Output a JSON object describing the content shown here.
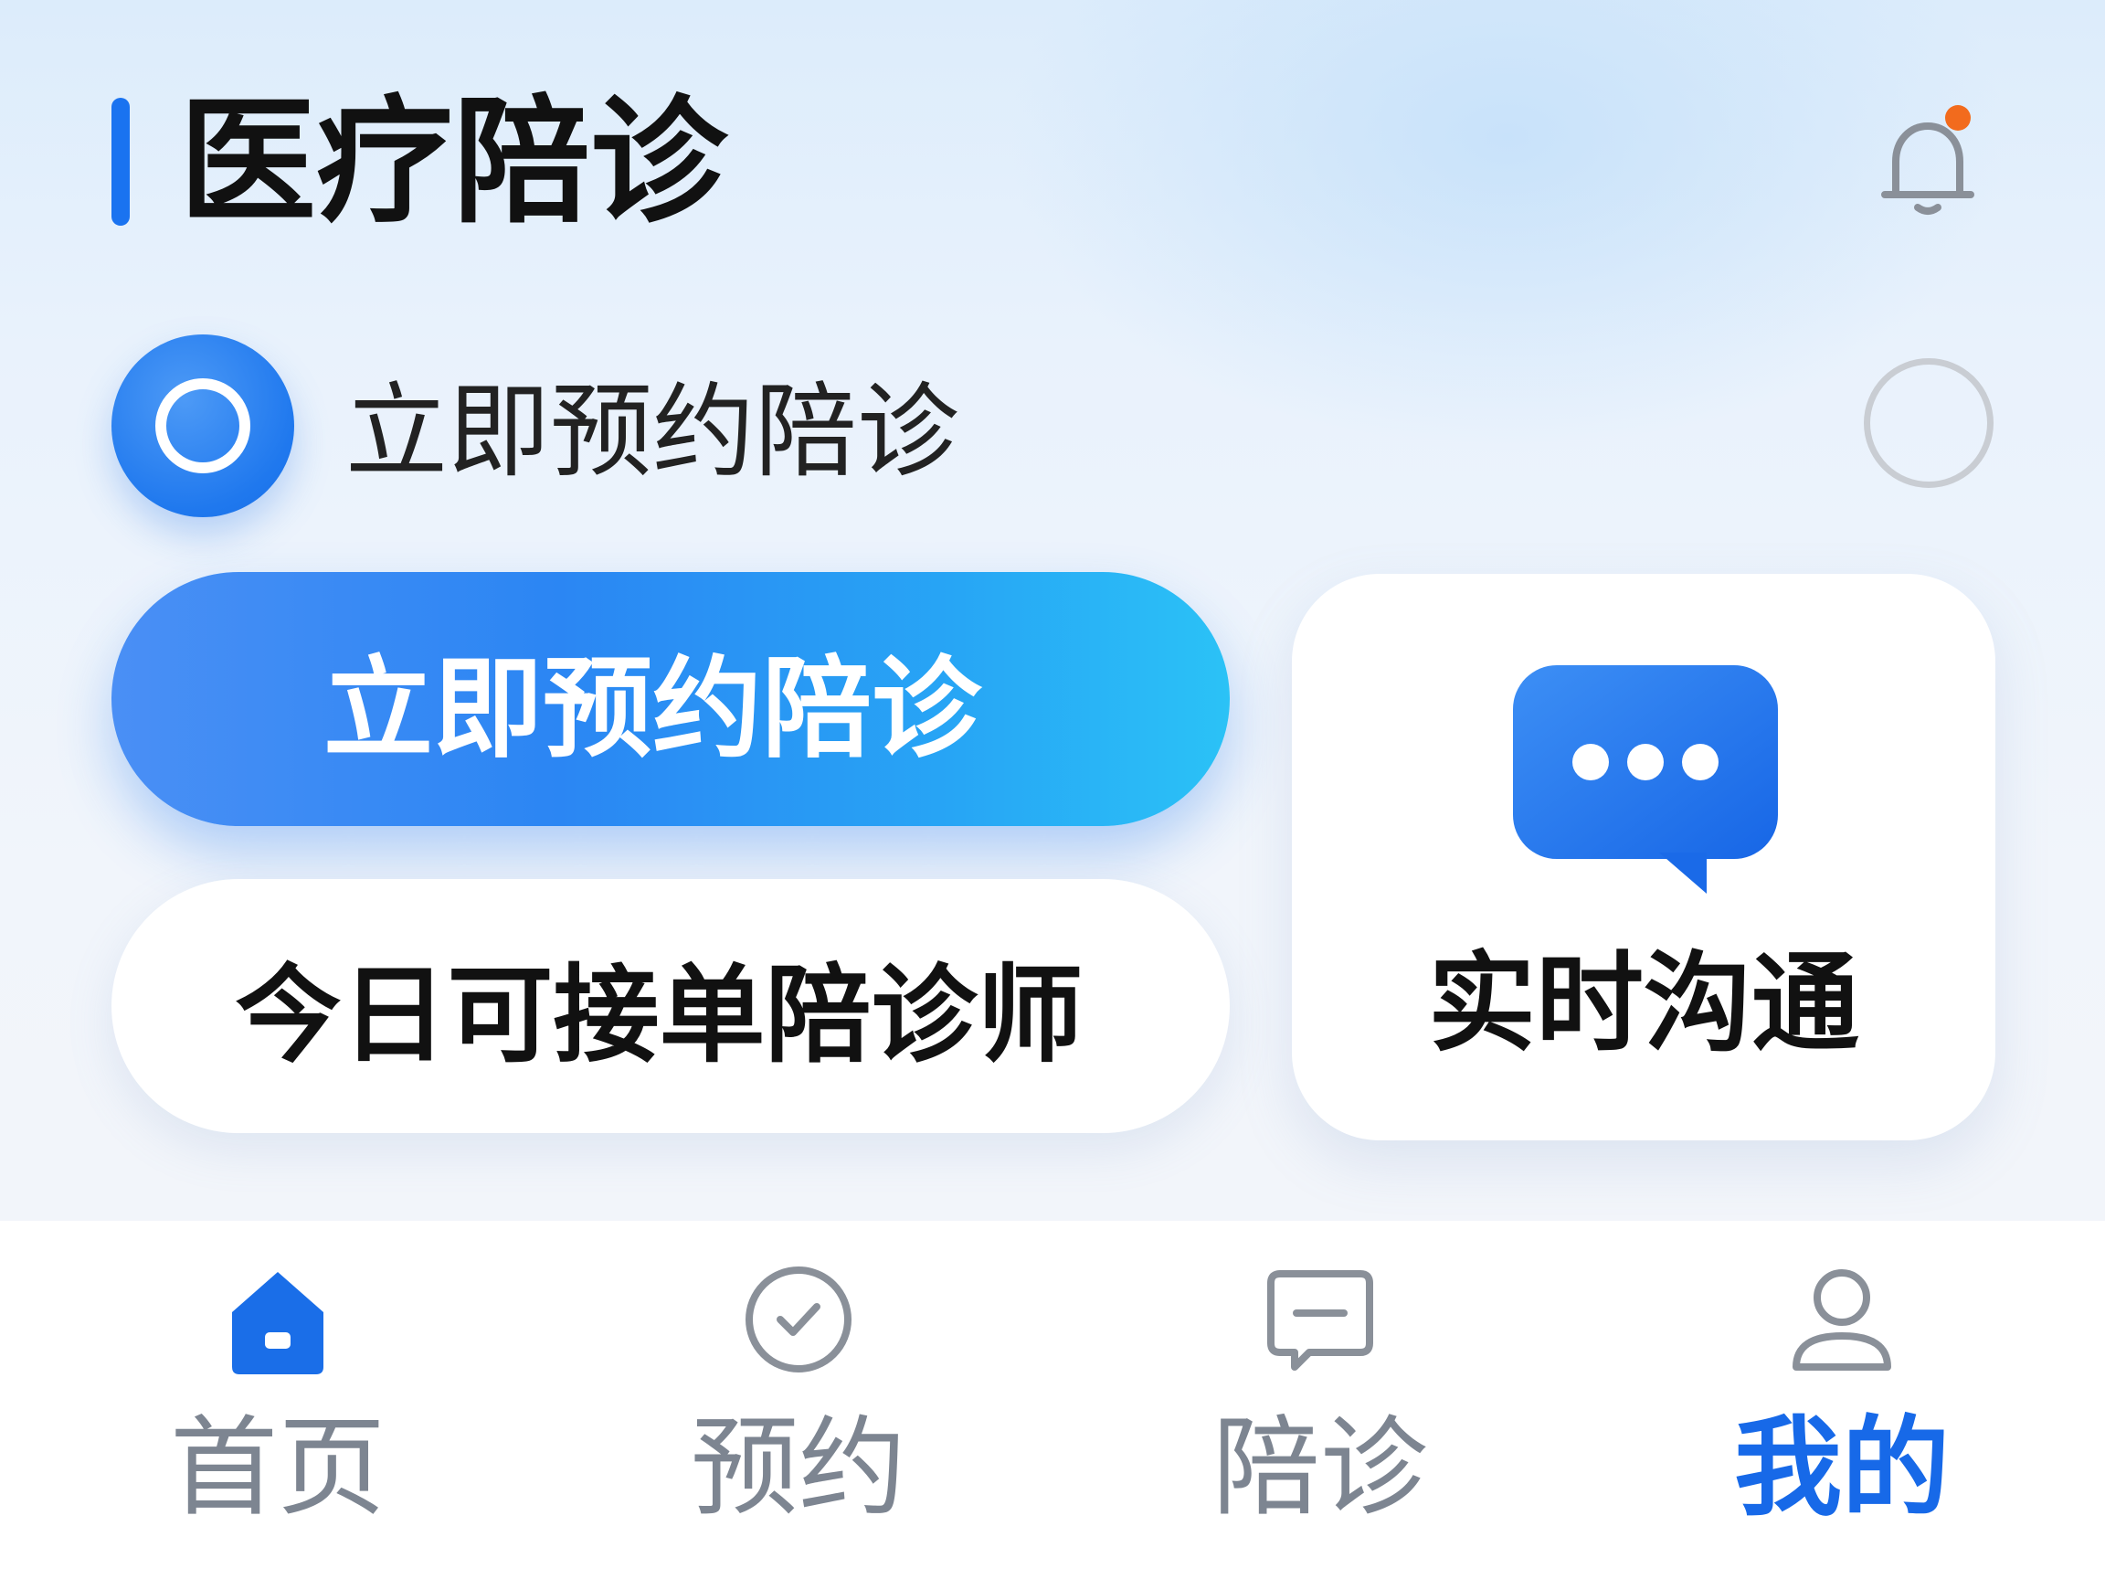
{
  "header": {
    "title": "医疗陪诊",
    "notification_icon": "bell-icon",
    "has_unread_dot": true,
    "dot_color": "#f26b1d"
  },
  "option_row": {
    "label": "立即预约陪诊",
    "selected": true
  },
  "actions": {
    "primary_label": "立即预约陪诊",
    "secondary_label": "今日可接单陪诊师",
    "chat_card_label": "实时沟通",
    "chat_icon": "chat-bubble-icon"
  },
  "bottom_nav": {
    "items": [
      {
        "label": "首页",
        "icon": "home-icon",
        "active": false
      },
      {
        "label": "预约",
        "icon": "check-circle-icon",
        "active": false
      },
      {
        "label": "陪诊",
        "icon": "message-icon",
        "active": false
      },
      {
        "label": "我的",
        "icon": "user-icon",
        "active": true
      }
    ]
  },
  "colors": {
    "accent": "#1a73f0",
    "active_nav": "#1769e8",
    "inactive_nav": "#7d8591"
  }
}
